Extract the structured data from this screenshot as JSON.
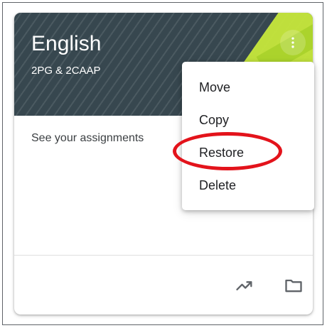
{
  "course": {
    "title": "English",
    "section": "2PG & 2CAAP",
    "assignments_link": "See your assignments"
  },
  "context_menu": {
    "items": [
      "Move",
      "Copy",
      "Restore",
      "Delete"
    ]
  },
  "icons": {
    "more": "more-vert-icon",
    "progress": "trending-up-icon",
    "folder": "folder-icon"
  },
  "colors": {
    "banner": "#37474f",
    "highlight_ring": "#e3131b",
    "accent": "#c6e83b"
  }
}
